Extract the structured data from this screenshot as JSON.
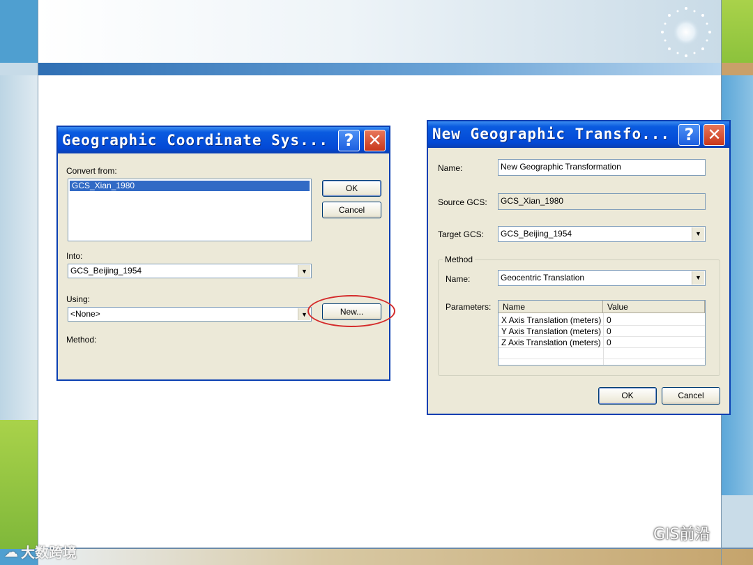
{
  "slide": {
    "watermark_text": "GIS前沿",
    "corner_text": "大数跨境"
  },
  "dialog1": {
    "title": "Geographic Coordinate Sys...",
    "help_button": "?",
    "close_button": "✕",
    "convert_from_label": "Convert from:",
    "convert_from_items": [
      "GCS_Xian_1980"
    ],
    "into_label": "Into:",
    "into_value": "GCS_Beijing_1954",
    "using_label": "Using:",
    "using_value": "<None>",
    "method_label": "Method:",
    "ok_label": "OK",
    "cancel_label": "Cancel",
    "new_label": "New..."
  },
  "dialog2": {
    "title": "New Geographic Transfo...",
    "help_button": "?",
    "close_button": "✕",
    "name_label": "Name:",
    "name_value": "New Geographic Transformation",
    "source_label": "Source GCS:",
    "source_value": "GCS_Xian_1980",
    "target_label": "Target GCS:",
    "target_value": "GCS_Beijing_1954",
    "method_group_label": "Method",
    "method_name_label": "Name:",
    "method_name_value": "Geocentric Translation",
    "parameters_label": "Parameters:",
    "param_columns": [
      "Name",
      "Value"
    ],
    "params": [
      {
        "name": "X Axis Translation (meters)",
        "value": "0"
      },
      {
        "name": "Y Axis Translation (meters)",
        "value": "0"
      },
      {
        "name": "Z Axis Translation (meters)",
        "value": "0"
      }
    ],
    "ok_label": "OK",
    "cancel_label": "Cancel"
  },
  "colors": {
    "title_bar": "#0349d6",
    "dialog_bg": "#ece9d8",
    "selection": "#316ac5",
    "highlight_ellipse": "#d42a2a"
  }
}
